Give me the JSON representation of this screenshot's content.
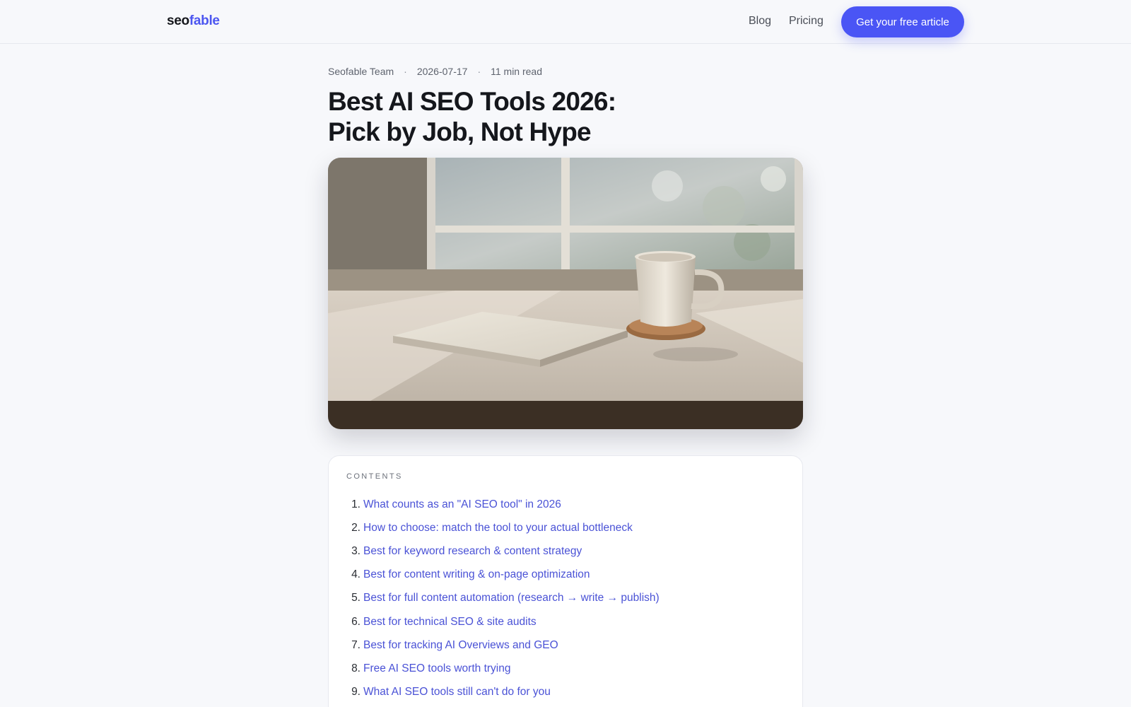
{
  "header": {
    "logo_part1": "seo",
    "logo_part2": "fable",
    "nav": [
      "Blog",
      "Pricing"
    ],
    "cta_label": "Get your free article"
  },
  "article": {
    "author": "Seofable Team",
    "date": "2026-07-17",
    "read_time": "11 min read",
    "separator": "·",
    "title_line1": "Best AI SEO Tools 2026:",
    "title_line2": "Pick by Job, Not Hype"
  },
  "hero_image": {
    "subject": "coffee mug and closed book on a wooden desk by a sunlit window"
  },
  "toc": {
    "label": "CONTENTS",
    "items": [
      {
        "num": "1.",
        "label": "What counts as an \"AI SEO tool\" in 2026"
      },
      {
        "num": "2.",
        "label": "How to choose: match the tool to your actual bottleneck"
      },
      {
        "num": "3.",
        "label": "Best for keyword research & content strategy"
      },
      {
        "num": "4.",
        "label": "Best for content writing & on-page optimization"
      },
      {
        "num": "5.",
        "label": "Best for full content automation (research → write → publish)"
      },
      {
        "num": "6.",
        "label": "Best for technical SEO & site audits"
      },
      {
        "num": "7.",
        "label": "Best for tracking AI Overviews and GEO"
      },
      {
        "num": "8.",
        "label": "Free AI SEO tools worth trying"
      },
      {
        "num": "9.",
        "label": "What AI SEO tools still can't do for you"
      }
    ]
  },
  "colors": {
    "accent": "#4a55f5",
    "link": "#4a52d6",
    "background": "#f7f8fb"
  }
}
